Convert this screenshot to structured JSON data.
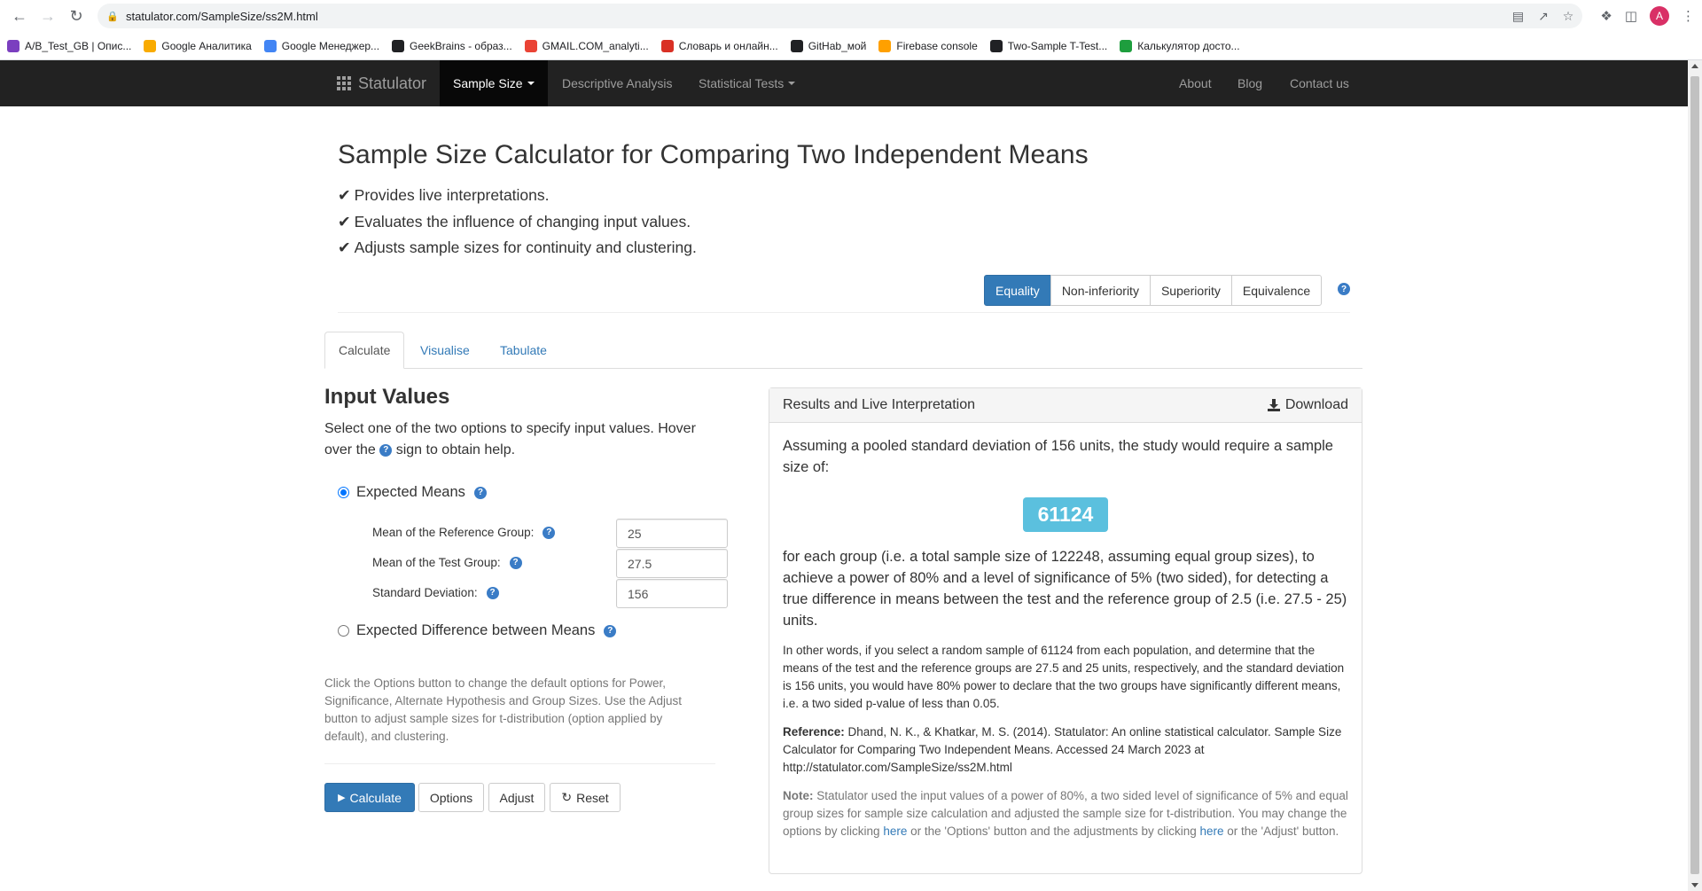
{
  "browser": {
    "url": "statulator.com/SampleSize/ss2M.html",
    "profile_initial": "A",
    "bookmarks": [
      {
        "label": "A/B_Test_GB | Опис...",
        "color": "#7b3fbf"
      },
      {
        "label": "Google Аналитика",
        "color": "#f9ab00"
      },
      {
        "label": "Google Менеджер...",
        "color": "#4285f4"
      },
      {
        "label": "GeekBrains - образ...",
        "color": "#202124"
      },
      {
        "label": "GMAIL.COM_analyti...",
        "color": "#ea4335"
      },
      {
        "label": "Словарь и онлайн...",
        "color": "#d93025"
      },
      {
        "label": "GitHab_мой",
        "color": "#202124"
      },
      {
        "label": "Firebase console",
        "color": "#ffa000"
      },
      {
        "label": "Two-Sample T-Test...",
        "color": "#202124"
      },
      {
        "label": "Калькулятор досто...",
        "color": "#1e9e3e"
      }
    ]
  },
  "site_nav": {
    "brand": "Statulator",
    "items": [
      {
        "label": "Sample Size",
        "active": true,
        "caret": true
      },
      {
        "label": "Descriptive Analysis",
        "active": false,
        "caret": false
      },
      {
        "label": "Statistical Tests",
        "active": false,
        "caret": true
      }
    ],
    "right_items": [
      "About",
      "Blog",
      "Contact us"
    ]
  },
  "page": {
    "title": "Sample Size Calculator for Comparing Two Independent Means",
    "features": [
      "Provides live interpretations.",
      "Evaluates the influence of changing input values.",
      "Adjusts sample sizes for continuity and clustering."
    ],
    "hypothesis_buttons": [
      "Equality",
      "Non-inferiority",
      "Superiority",
      "Equivalence"
    ],
    "hypothesis_selected": "Equality",
    "tabs": [
      "Calculate",
      "Visualise",
      "Tabulate"
    ],
    "active_tab": "Calculate"
  },
  "inputs": {
    "title": "Input Values",
    "desc_part1": "Select one of the two options to specify input values. Hover over the",
    "desc_part2": "sign to obtain help.",
    "option_means": "Expected Means",
    "option_diff": "Expected Difference between Means",
    "fields": [
      {
        "label": "Mean of the Reference Group:",
        "value": "25"
      },
      {
        "label": "Mean of the Test Group:",
        "value": "27.5"
      },
      {
        "label": "Standard Deviation:",
        "value": "156"
      }
    ],
    "options_note": "Click the Options button to change the default options for Power, Significance, Alternate Hypothesis and Group Sizes. Use the Adjust button to adjust sample sizes for t-distribution (option applied by default), and clustering.",
    "buttons": {
      "calculate": "Calculate",
      "options": "Options",
      "adjust": "Adjust",
      "reset": "Reset"
    }
  },
  "results": {
    "header": "Results and Live Interpretation",
    "download": "Download",
    "lead": "Assuming a pooled standard deviation of 156 units, the study would require a sample size of:",
    "sample_size": "61124",
    "after": "for each group (i.e. a total sample size of 122248, assuming equal group sizes), to achieve a power of 80% and a level of significance of 5% (two sided), for detecting a true difference in means between the test and the reference group of 2.5 (i.e. 27.5 - 25) units.",
    "other_words": "In other words, if you select a random sample of 61124 from each population, and determine that the means of the test and the reference groups are 27.5 and 25 units, respectively, and the standard deviation is 156 units, you would have 80% power to declare that the two groups have significantly different means, i.e. a two sided p-value of less than 0.05.",
    "reference_label": "Reference:",
    "reference_text": "Dhand, N. K., & Khatkar, M. S. (2014). Statulator: An online statistical calculator. Sample Size Calculator for Comparing Two Independent Means. Accessed 24 March 2023 at http://statulator.com/SampleSize/ss2M.html",
    "note_label": "Note:",
    "note_part1": "Statulator used the input values of a power of 80%, a two sided level of significance of 5% and equal group sizes for sample size calculation and adjusted the sample size for t-distribution. You may change the options by clicking",
    "note_link1": "here",
    "note_part2": "or the 'Options' button and the adjustments by clicking",
    "note_link2": "here",
    "note_part3": "or the 'Adjust' button."
  }
}
